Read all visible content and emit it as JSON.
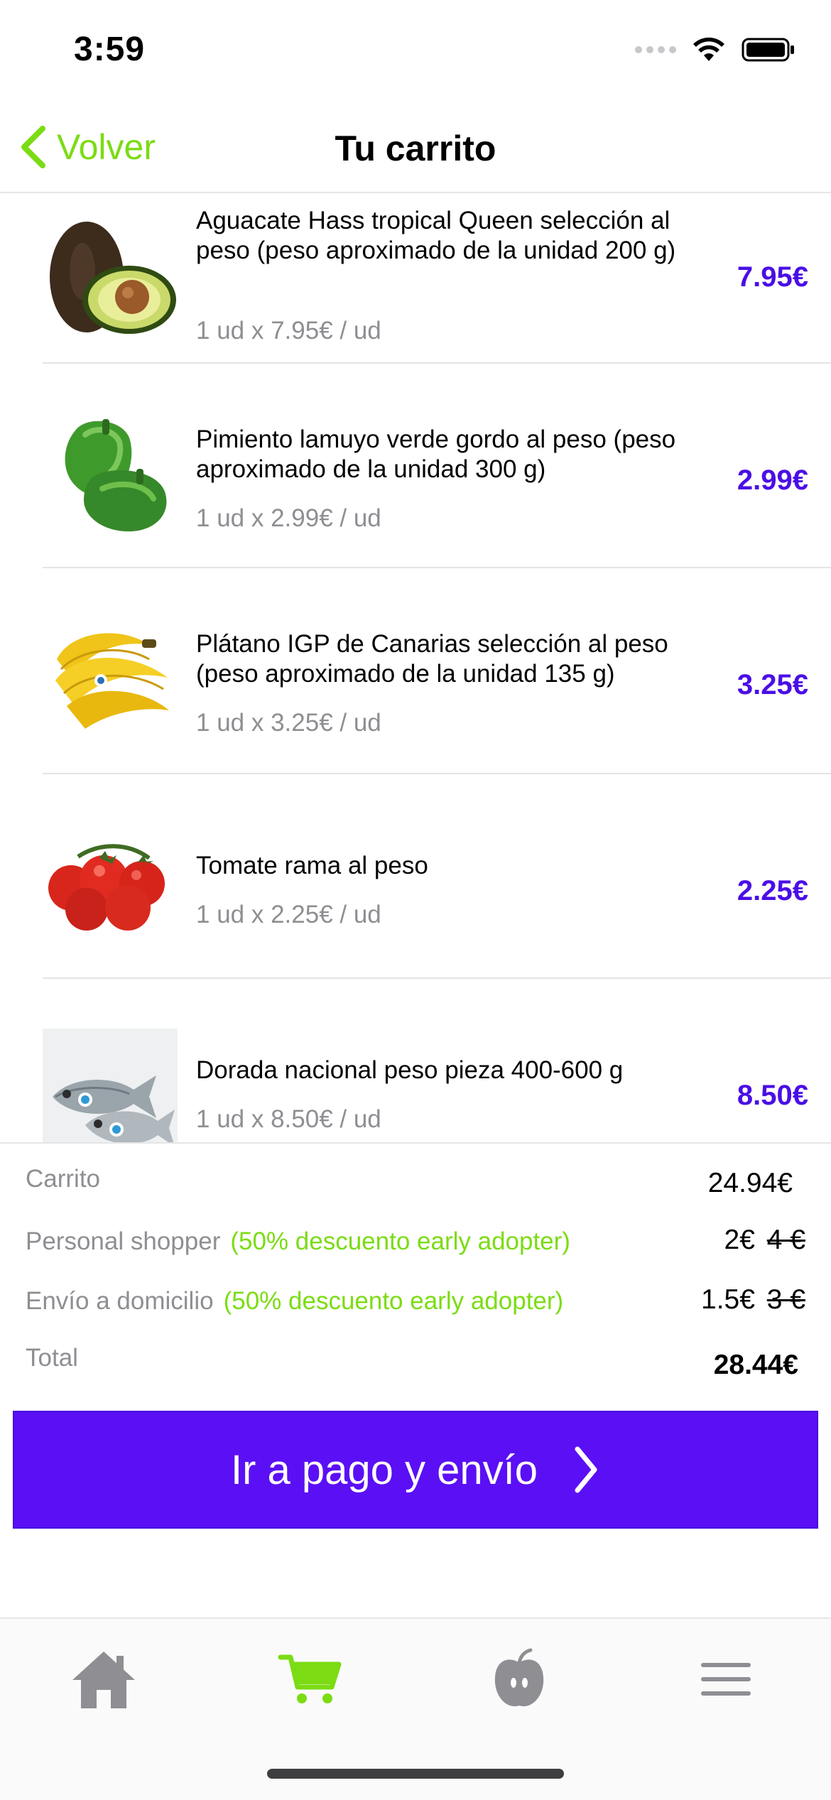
{
  "status": {
    "time": "3:59"
  },
  "nav": {
    "back_label": "Volver",
    "title": "Tu carrito"
  },
  "cart": {
    "items": [
      {
        "name": "Aguacate Hass tropical Queen selección al peso (peso aproximado de la unidad 200 g)",
        "detail": "1 ud x 7.95€ / ud",
        "price": "7.95€",
        "image": "avocado-image"
      },
      {
        "name": "Pimiento lamuyo verde gordo al peso (peso aproximado de la unidad 300 g)",
        "detail": "1 ud x 2.99€ / ud",
        "price": "2.99€",
        "image": "green-pepper-image"
      },
      {
        "name": "Plátano IGP de Canarias selección al peso (peso aproximado de la unidad 135 g)",
        "detail": "1 ud x 3.25€ / ud",
        "price": "3.25€",
        "image": "banana-image"
      },
      {
        "name": "Tomate rama al peso",
        "detail": "1 ud x 2.25€ / ud",
        "price": "2.25€",
        "image": "tomato-image"
      },
      {
        "name": "Dorada nacional peso pieza 400-600 g",
        "detail": "1 ud x 8.50€ / ud",
        "price": "8.50€",
        "image": "sea-bream-image"
      }
    ]
  },
  "summary": {
    "cart_label": "Carrito",
    "cart_value": "24.94€",
    "shopper_label": "Personal shopper",
    "shopper_promo": "(50% descuento early adopter)",
    "shopper_value": "2€",
    "shopper_old_value": "4 €",
    "delivery_label": "Envío a domicilio",
    "delivery_promo": "(50% descuento early adopter)",
    "delivery_value": "1.5€",
    "delivery_old_value": "3 €",
    "total_label": "Total",
    "total_value": "28.44€"
  },
  "checkout": {
    "label": "Ir a pago y envío"
  },
  "tabs": [
    {
      "icon": "home-icon",
      "active": false
    },
    {
      "icon": "cart-icon",
      "active": true
    },
    {
      "icon": "apple-icon",
      "active": false
    },
    {
      "icon": "menu-icon",
      "active": false
    }
  ],
  "colors": {
    "accent_green": "#7bdc13",
    "accent_purple": "#5b0ff5",
    "price_purple": "#4a0ee6",
    "muted_gray": "#8e8e93"
  }
}
